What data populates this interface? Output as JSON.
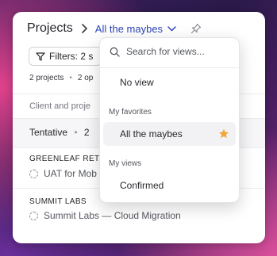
{
  "header": {
    "breadcrumb_root": "Projects",
    "current_view": "All the maybes"
  },
  "toolbar": {
    "filters_label": "Filters: 2 s"
  },
  "meta": {
    "projects_count": "2 projects",
    "second_stat": "2 op"
  },
  "table": {
    "group_header": "Client and proje"
  },
  "section": {
    "name": "Tentative",
    "count": "2"
  },
  "groups": [
    {
      "client": "GREENLEAF RETA",
      "project": "UAT for Mob"
    },
    {
      "client": "SUMMIT LABS",
      "project": "Summit Labs — Cloud Migration"
    }
  ],
  "dropdown": {
    "search_placeholder": "Search for views...",
    "no_view": "No view",
    "favorites_header": "My favorites",
    "favorite_item": "All the maybes",
    "my_views_header": "My views",
    "my_view_item": "Confirmed"
  },
  "colors": {
    "accent_blue": "#2d45b8",
    "star": "#f0a63a"
  }
}
